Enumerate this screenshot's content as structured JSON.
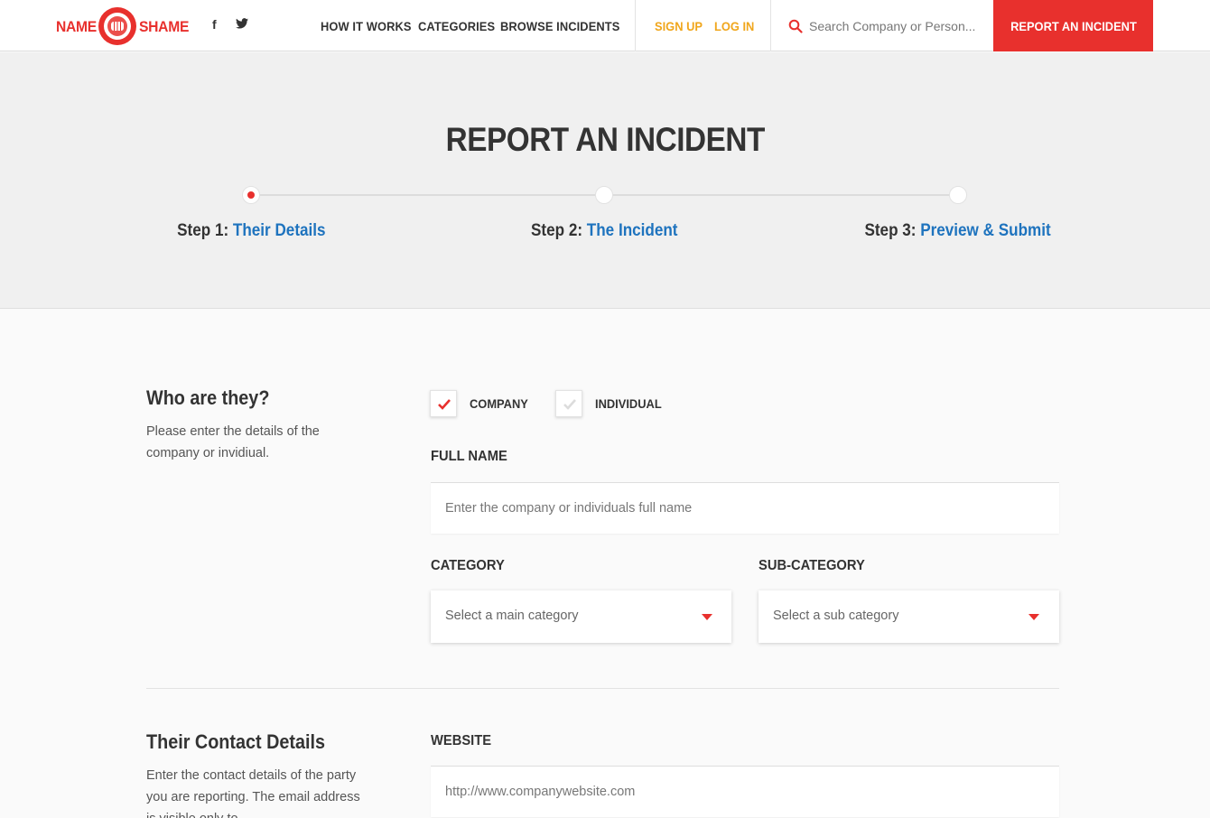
{
  "brand": {
    "name_left": "NAME",
    "name_right": "SHAME",
    "accent_color": "#e8302d",
    "link_color": "#1e73be",
    "auth_color": "#f0a61c"
  },
  "header": {
    "social": {
      "facebook": "f",
      "facebook_icon": "facebook-icon",
      "twitter_icon": "twitter-icon"
    },
    "nav": {
      "how_it_works": "HOW IT WORKS",
      "categories": "CATEGORIES",
      "browse_incidents": "BROWSE INCIDENTS"
    },
    "auth": {
      "sign_up": "SIGN UP",
      "log_in": "LOG IN"
    },
    "search": {
      "placeholder": "Search Company or Person..."
    },
    "report_button": "REPORT AN INCIDENT"
  },
  "hero": {
    "title": "REPORT AN INCIDENT",
    "steps": [
      {
        "prefix": "Step 1: ",
        "name": "Their Details",
        "active": true
      },
      {
        "prefix": "Step 2: ",
        "name": "The Incident",
        "active": false
      },
      {
        "prefix": "Step 3: ",
        "name": "Preview & Submit",
        "active": false
      }
    ]
  },
  "who_section": {
    "title": "Who are they?",
    "description": "Please enter the details of the company or invidiual.",
    "options": [
      {
        "label": "COMPANY",
        "checked": true
      },
      {
        "label": "INDIVIDUAL",
        "checked": false
      }
    ],
    "full_name": {
      "label": "FULL NAME",
      "placeholder": "Enter the company or individuals full name",
      "value": ""
    },
    "category": {
      "label": "CATEGORY",
      "selected": "Select a main category"
    },
    "sub_category": {
      "label": "SUB-CATEGORY",
      "selected": "Select a sub category"
    }
  },
  "contact_section": {
    "title": "Their Contact Details",
    "description": "Enter the contact details of the party you are reporting. The email address is visible only to",
    "website": {
      "label": "WEBSITE",
      "placeholder": "http://www.companywebsite.com",
      "value": ""
    }
  }
}
